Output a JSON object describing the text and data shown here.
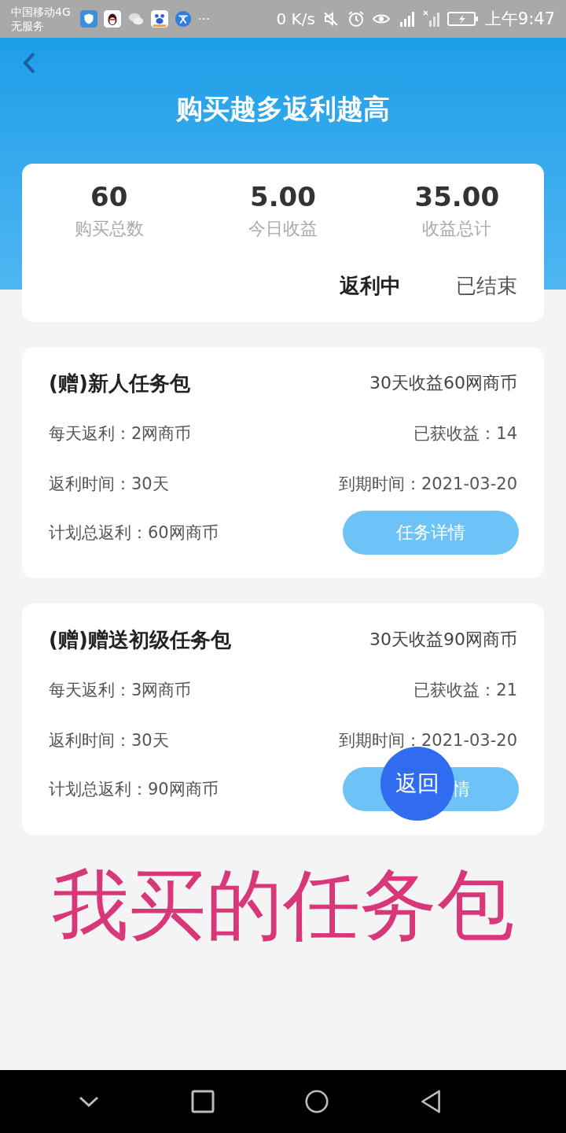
{
  "status_bar": {
    "carrier": "中国移动4G",
    "service": "无服务",
    "more": "···",
    "speed": "0 K/s",
    "time": "上午9:47"
  },
  "header": {
    "title": "购买越多返利越高"
  },
  "summary": {
    "stats": [
      {
        "value": "60",
        "label": "购买总数"
      },
      {
        "value": "5.00",
        "label": "今日收益"
      },
      {
        "value": "35.00",
        "label": "收益总计"
      }
    ],
    "tabs": [
      {
        "label": "返利中",
        "selected": true
      },
      {
        "label": "已结束",
        "selected": false
      }
    ]
  },
  "packages": [
    {
      "name": "(赠)新人任务包",
      "summary": "30天收益60网商币",
      "daily": "每天返利：2网商币",
      "earned": "已获收益：14",
      "duration": "返利时间：30天",
      "expiry": "到期时间：2021-03-20",
      "total": "计划总返利：60网商币",
      "button": "任务详情"
    },
    {
      "name": "(赠)赠送初级任务包",
      "summary": "30天收益90网商币",
      "daily": "每天返利：3网商币",
      "earned": "已获收益：21",
      "duration": "返利时间：30天",
      "expiry": "到期时间：2021-03-20",
      "total": "计划总返利：90网商币",
      "button": "情"
    }
  ],
  "floating_button": {
    "label": "返回"
  },
  "annotation": "我买的任务包"
}
